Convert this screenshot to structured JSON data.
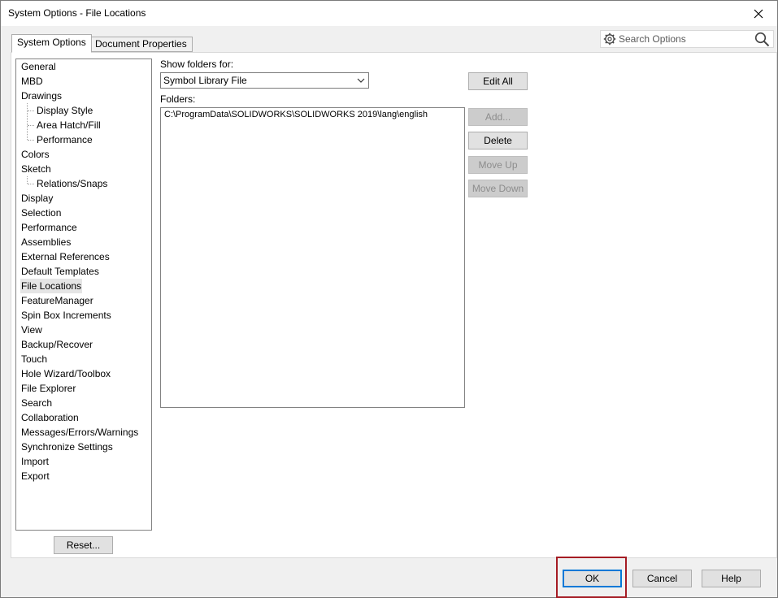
{
  "window": {
    "title": "System Options - File Locations",
    "close_glyph": "×"
  },
  "tabs": [
    {
      "label": "System Options",
      "active": true
    },
    {
      "label": "Document Properties",
      "active": false
    }
  ],
  "search": {
    "placeholder": "Search Options",
    "icon_left": "gear-icon",
    "icon_right": "magnifier-icon"
  },
  "tree": {
    "items": [
      {
        "label": "General",
        "level": 0
      },
      {
        "label": "MBD",
        "level": 0
      },
      {
        "label": "Drawings",
        "level": 0
      },
      {
        "label": "Display Style",
        "level": 1
      },
      {
        "label": "Area Hatch/Fill",
        "level": 1
      },
      {
        "label": "Performance",
        "level": 1
      },
      {
        "label": "Colors",
        "level": 0
      },
      {
        "label": "Sketch",
        "level": 0
      },
      {
        "label": "Relations/Snaps",
        "level": 1
      },
      {
        "label": "Display",
        "level": 0
      },
      {
        "label": "Selection",
        "level": 0
      },
      {
        "label": "Performance",
        "level": 0
      },
      {
        "label": "Assemblies",
        "level": 0
      },
      {
        "label": "External References",
        "level": 0
      },
      {
        "label": "Default Templates",
        "level": 0
      },
      {
        "label": "File Locations",
        "level": 0,
        "selected": true
      },
      {
        "label": "FeatureManager",
        "level": 0
      },
      {
        "label": "Spin Box Increments",
        "level": 0
      },
      {
        "label": "View",
        "level": 0
      },
      {
        "label": "Backup/Recover",
        "level": 0
      },
      {
        "label": "Touch",
        "level": 0
      },
      {
        "label": "Hole Wizard/Toolbox",
        "level": 0
      },
      {
        "label": "File Explorer",
        "level": 0
      },
      {
        "label": "Search",
        "level": 0
      },
      {
        "label": "Collaboration",
        "level": 0
      },
      {
        "label": "Messages/Errors/Warnings",
        "level": 0
      },
      {
        "label": "Synchronize Settings",
        "level": 0
      },
      {
        "label": "Import",
        "level": 0
      },
      {
        "label": "Export",
        "level": 0
      }
    ],
    "reset_label": "Reset..."
  },
  "main": {
    "show_folders_label": "Show folders for:",
    "show_folders_value": "Symbol Library File",
    "folders_label": "Folders:",
    "folders": [
      "C:\\ProgramData\\SOLIDWORKS\\SOLIDWORKS 2019\\lang\\english"
    ],
    "buttons": {
      "edit_all": "Edit All",
      "add": "Add...",
      "delete": "Delete",
      "move_up": "Move Up",
      "move_down": "Move Down"
    }
  },
  "footer": {
    "ok": "OK",
    "cancel": "Cancel",
    "help": "Help"
  },
  "colors": {
    "highlight_border": "#a51c24",
    "focus_blue": "#0078d7"
  }
}
